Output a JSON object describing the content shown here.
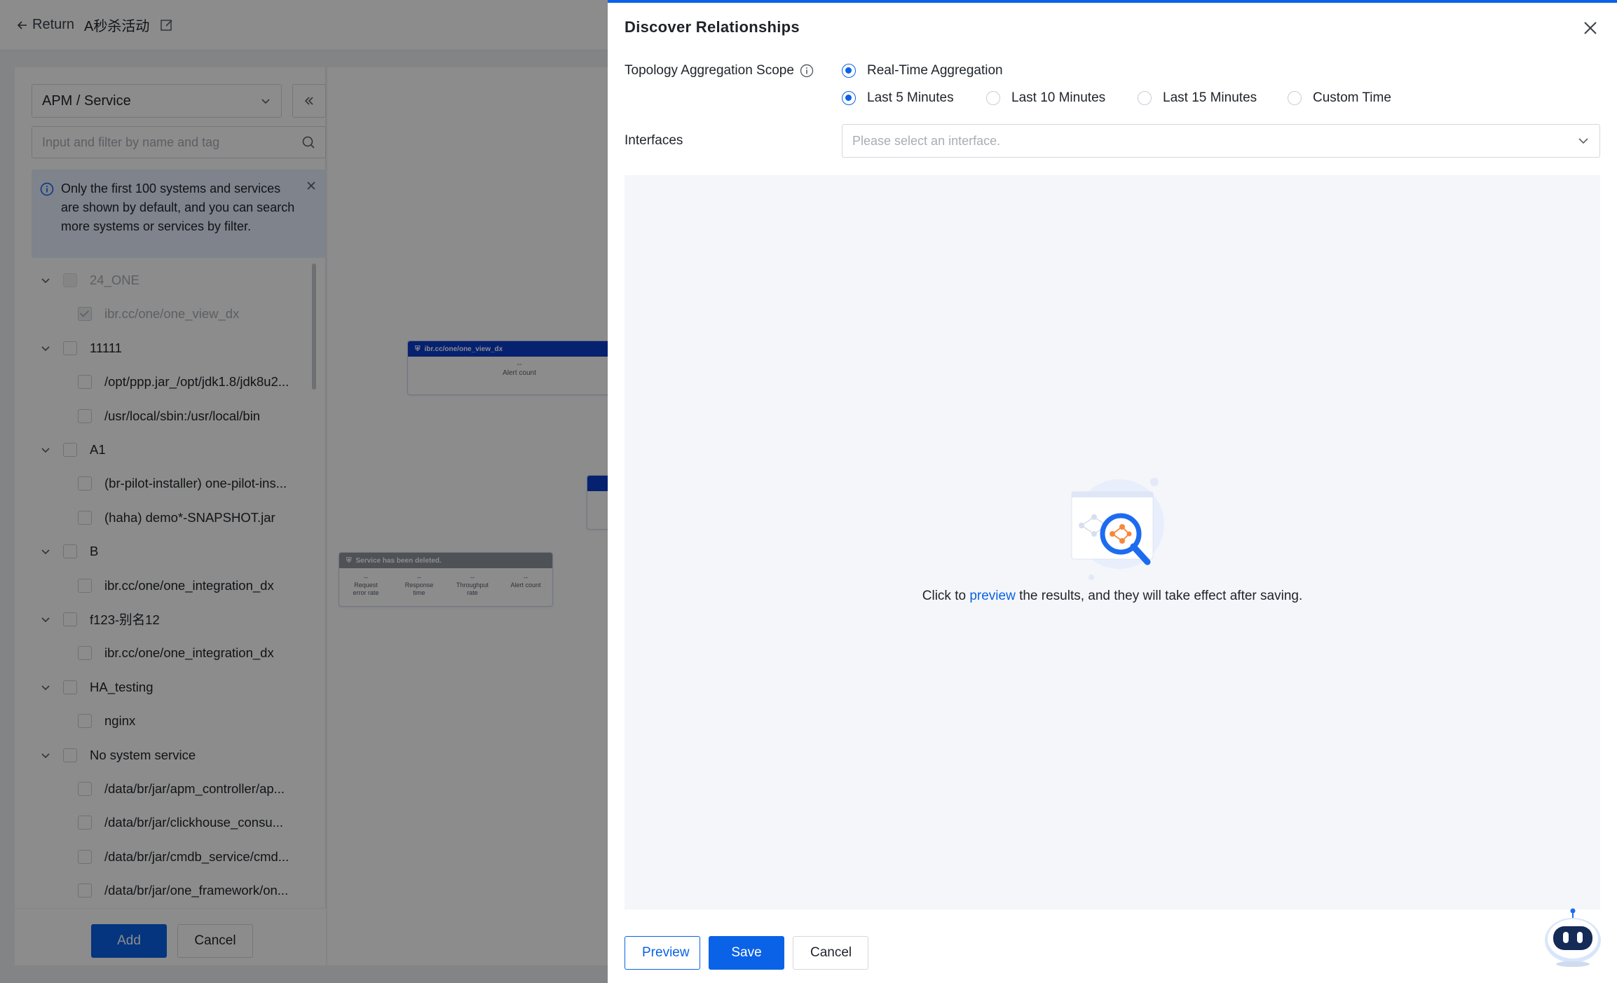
{
  "topbar": {
    "back_label": "Return",
    "page_title": "A秒杀活动"
  },
  "left_panel": {
    "service_type": "APM / Service",
    "filter_placeholder": "Input and filter by name and tag",
    "notice": "Only the first 100 systems and services are shown by default, and you can search more systems or services by filter.",
    "tree": [
      {
        "label": "24_ONE",
        "level": 0,
        "muted": true
      },
      {
        "label": "ibr.cc/one/one_view_dx",
        "level": 1,
        "muted": true,
        "checked": true
      },
      {
        "label": "11111",
        "level": 0
      },
      {
        "label": "/opt/ppp.jar_/opt/jdk1.8/jdk8u2...",
        "level": 1
      },
      {
        "label": "/usr/local/sbin:/usr/local/bin",
        "level": 1
      },
      {
        "label": "A1",
        "level": 0
      },
      {
        "label": "(br-pilot-installer) one-pilot-ins...",
        "level": 1
      },
      {
        "label": "(haha) demo*-SNAPSHOT.jar",
        "level": 1
      },
      {
        "label": "B",
        "level": 0
      },
      {
        "label": "ibr.cc/one/one_integration_dx",
        "level": 1
      },
      {
        "label": "f123-别名12",
        "level": 0
      },
      {
        "label": "ibr.cc/one/one_integration_dx",
        "level": 1
      },
      {
        "label": "HA_testing",
        "level": 0
      },
      {
        "label": "nginx",
        "level": 1
      },
      {
        "label": "No system service",
        "level": 0
      },
      {
        "label": "/data/br/jar/apm_controller/ap...",
        "level": 1
      },
      {
        "label": "/data/br/jar/clickhouse_consu...",
        "level": 1
      },
      {
        "label": "/data/br/jar/cmdb_service/cmd...",
        "level": 1
      },
      {
        "label": "/data/br/jar/one_framework/on...",
        "level": 1
      }
    ],
    "add_label": "Add",
    "cancel_label": "Cancel"
  },
  "canvas": {
    "node1": {
      "title": "ibr.cc/one/one_view_dx",
      "value": "--",
      "metric": "Alert count"
    },
    "node_deleted": {
      "title": "Service has been deleted.",
      "metrics": [
        {
          "value": "--",
          "label": "Request error rate"
        },
        {
          "value": "--",
          "label": "Response time"
        },
        {
          "value": "--",
          "label": "Throughput rate"
        },
        {
          "value": "--",
          "label": "Alert count"
        }
      ]
    }
  },
  "drawer": {
    "title": "Discover Relationships",
    "scope_label": "Topology Aggregation Scope",
    "aggregation_option": "Real-Time Aggregation",
    "time_options": [
      "Last 5 Minutes",
      "Last 10 Minutes",
      "Last 15 Minutes",
      "Custom Time"
    ],
    "selected_time": "Last 5 Minutes",
    "interfaces_label": "Interfaces",
    "interfaces_placeholder": "Please select an interface.",
    "empty_prefix": "Click to ",
    "empty_link": "preview",
    "empty_suffix": " the results, and they will take effect after saving.",
    "preview_label": "Preview",
    "save_label": "Save",
    "cancel_label": "Cancel"
  },
  "colors": {
    "primary": "#0a62e6",
    "overlay": "rgba(0,0,0,0.45)"
  }
}
